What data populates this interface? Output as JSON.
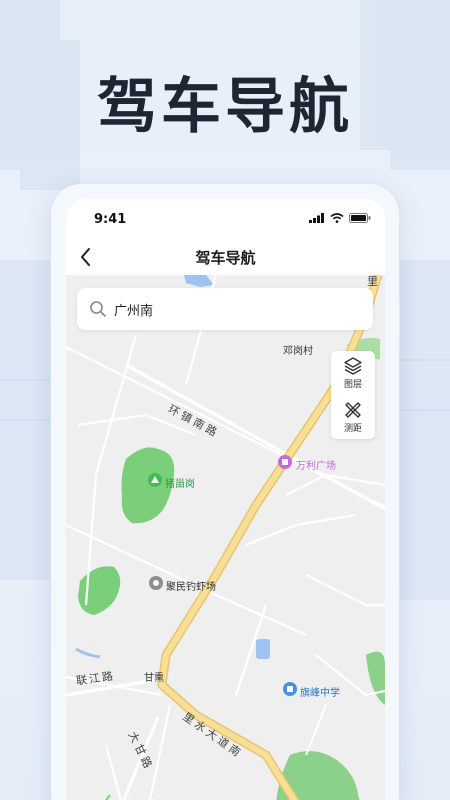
{
  "headline": "驾车导航",
  "status_bar": {
    "time": "9:41"
  },
  "nav": {
    "title": "驾车导航"
  },
  "search": {
    "value": "广州南"
  },
  "tools": [
    {
      "label": "图层",
      "icon": "layers-icon"
    },
    {
      "label": "测距",
      "icon": "ruler-icon"
    }
  ],
  "map": {
    "places": {
      "village": "邓岗村",
      "mall": "万利广场",
      "hill": "猪甾岗",
      "fishing": "聚民钓虾场",
      "school": "旗峰中学",
      "ganxun": "甘熏"
    },
    "roads": {
      "huanzhen": "环镇南路",
      "lianjiang": "联江路",
      "lishui": "里水大道南",
      "dagan": "大甘路",
      "top_vertical": "里"
    }
  },
  "colors": {
    "main_road": "#f5d98c",
    "green": "#7ccf7a",
    "water": "#9fc3ef",
    "mall_poi": "#c46ad8",
    "school_poi": "#4a90d9",
    "hill_poi": "#3dba5a"
  }
}
